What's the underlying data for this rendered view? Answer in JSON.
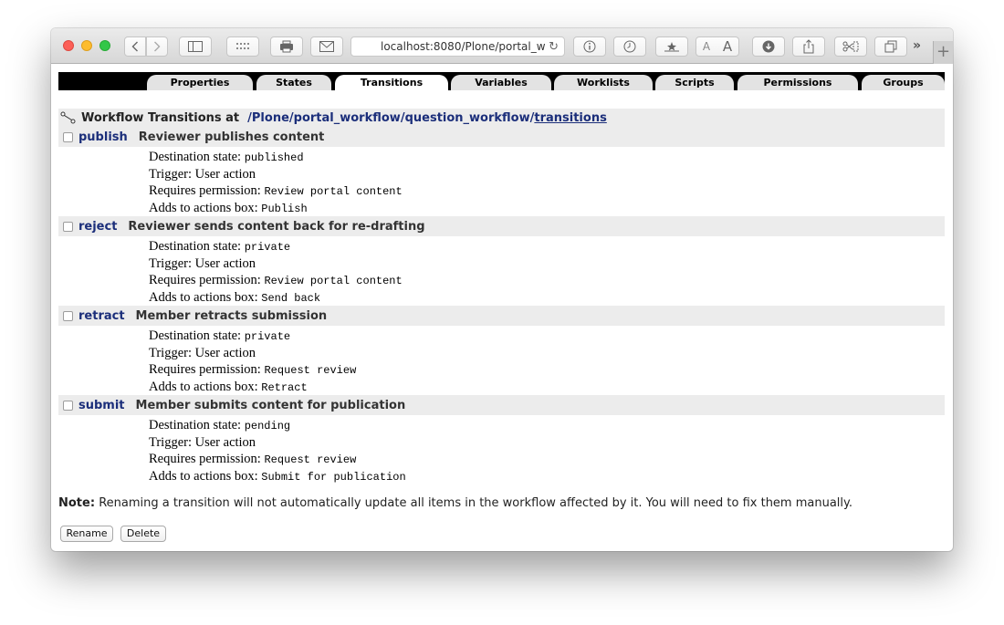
{
  "browser": {
    "address": "localhost:8080/Plone/portal_w",
    "address_fade": "",
    "reader_a_small": "A",
    "reader_a_large": "A"
  },
  "tabs": [
    {
      "label": "Properties"
    },
    {
      "label": "States"
    },
    {
      "label": "Transitions"
    },
    {
      "label": "Variables"
    },
    {
      "label": "Worklists"
    },
    {
      "label": "Scripts"
    },
    {
      "label": "Permissions"
    },
    {
      "label": "Groups"
    }
  ],
  "heading": {
    "prefix": "Workflow Transitions at",
    "path": [
      "/Plone",
      "/portal_workflow",
      "/question_workflow",
      "/"
    ],
    "current": "transitions"
  },
  "labels": {
    "destination": "Destination state:",
    "trigger": "Trigger:",
    "permission": "Requires permission:",
    "actions_box": "Adds to actions box:"
  },
  "transitions": [
    {
      "id": "publish",
      "title": "Reviewer publishes content",
      "destination": "published",
      "trigger": "User action",
      "permission": "Review portal content",
      "actions_box": "Publish"
    },
    {
      "id": "reject",
      "title": "Reviewer sends content back for re-drafting",
      "destination": "private",
      "trigger": "User action",
      "permission": "Review portal content",
      "actions_box": "Send back"
    },
    {
      "id": "retract",
      "title": "Member retracts submission",
      "destination": "private",
      "trigger": "User action",
      "permission": "Request review",
      "actions_box": "Retract"
    },
    {
      "id": "submit",
      "title": "Member submits content for publication",
      "destination": "pending",
      "trigger": "User action",
      "permission": "Request review",
      "actions_box": "Submit for publication"
    }
  ],
  "note": {
    "label": "Note:",
    "text": "Renaming a transition will not automatically update all items in the workflow affected by it. You will need to fix them manually."
  },
  "buttons": {
    "rename": "Rename",
    "delete": "Delete"
  }
}
